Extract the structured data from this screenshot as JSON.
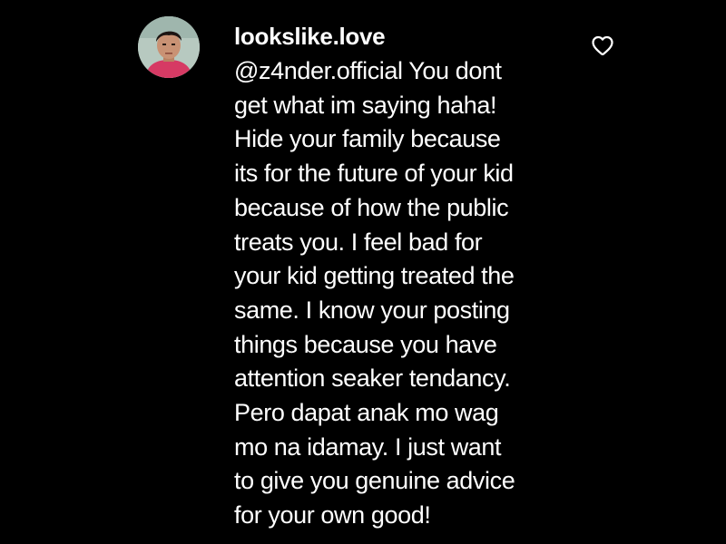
{
  "comment": {
    "username": "lookslike.love",
    "text_lines": [
      "@z4nder.official You dont",
      "get what im saying haha!",
      "Hide your family because",
      "its for the future of your kid",
      "because of how the public",
      "treats you. I feel bad for",
      "your kid getting treated the",
      "same. I know your posting",
      "things because you have",
      "attention seaker tendancy.",
      "Pero dapat anak mo wag",
      "mo na idamay. I just want",
      "to give you genuine advice",
      "for your own good!"
    ],
    "avatar_icon": "profile-photo",
    "like_icon": "heart-outline-icon"
  },
  "colors": {
    "background": "#000000",
    "text": "#ffffff",
    "avatar_backdrop": "#b7c9c0",
    "avatar_shirt": "#d63a64"
  }
}
